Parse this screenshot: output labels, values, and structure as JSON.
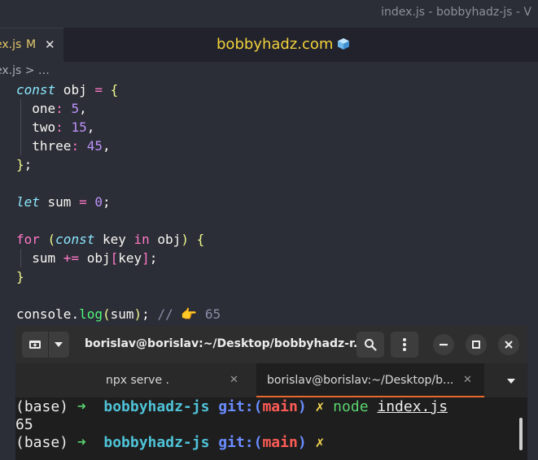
{
  "window_title": "index.js - bobbyhadz-js - V",
  "editor": {
    "tab": {
      "name": "ex.js",
      "modified": "M",
      "close": "✕"
    },
    "brand": "bobbyhadz.com",
    "breadcrumb": "ex.js > …",
    "code": {
      "l1": {
        "a": "const",
        "b": " obj ",
        "c": "=",
        "d": " {"
      },
      "l2": {
        "a": "  one",
        "b": ":",
        "c": " 5",
        "d": ","
      },
      "l3": {
        "a": "  two",
        "b": ":",
        "c": " 15",
        "d": ","
      },
      "l4": {
        "a": "  three",
        "b": ":",
        "c": " 45",
        "d": ","
      },
      "l5": {
        "a": "}",
        "b": ";"
      },
      "l7": {
        "a": "let",
        "b": " sum ",
        "c": "=",
        "d": " 0",
        "e": ";"
      },
      "l9": {
        "a": "for",
        "b": " (",
        "c": "const",
        "d": " key ",
        "e": "in",
        "f": " obj",
        "g": ") {"
      },
      "l10": {
        "a": "  sum ",
        "b": "+=",
        "c": " obj",
        "d": "[",
        "e": "key",
        "f": "]",
        "g": ";"
      },
      "l11": {
        "a": "}"
      },
      "l13": {
        "a": "console",
        "b": ".",
        "c": "log",
        "d": "(",
        "e": "sum",
        "f": ")",
        "g": ";",
        "h": " // ",
        "i": "👉",
        "j": " 65"
      }
    }
  },
  "terminal": {
    "title": "borislav@borislav:~/Desktop/bobbyhadz-r...",
    "tabs": [
      {
        "label": "npx serve .",
        "close": "✕"
      },
      {
        "label": "borislav@borislav:~/Desktop/b...",
        "close": "✕"
      }
    ],
    "lines": {
      "l1": {
        "prefix": "(base) ",
        "arrow": "➜",
        "project": "  bobbyhadz-js",
        "git": " git:(",
        "branch": "main",
        "git_close": ")",
        "mark": " ✗",
        "cmd": " node",
        "sp": " ",
        "file": "index.js"
      },
      "l2": {
        "text": "65"
      },
      "l3": {
        "prefix": "(base) ",
        "arrow": "➜",
        "project": "  bobbyhadz-js",
        "git": " git:(",
        "branch": "main",
        "git_close": ")",
        "mark": " ✗"
      }
    }
  },
  "colors": {
    "editor_bg": "#2b2d37",
    "brand": "#f2d23c",
    "terminal_bg": "#1e1e1e",
    "active_tab_underline": "#e8692b"
  }
}
